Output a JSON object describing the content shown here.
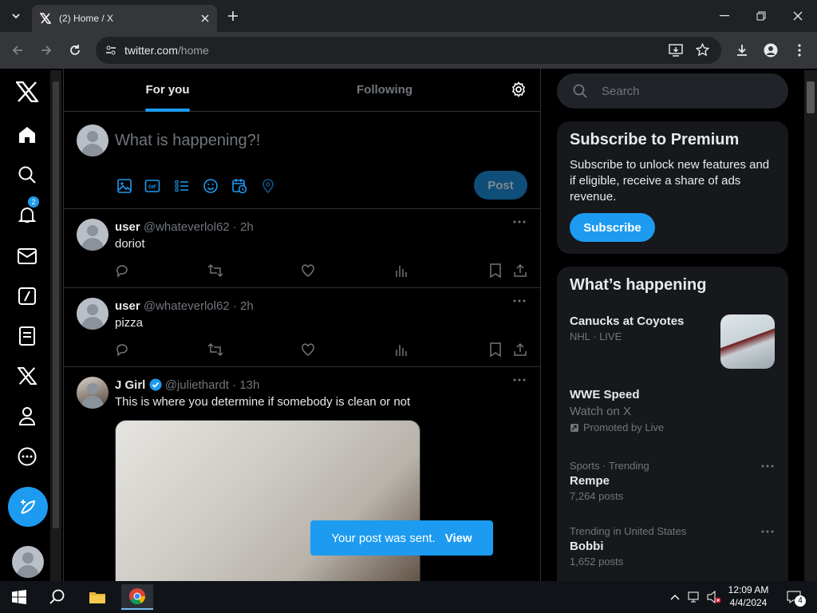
{
  "browser": {
    "tab_title": "(2) Home / X",
    "url_host": "twitter.com",
    "url_path": "/home"
  },
  "nav": {
    "notification_count": "2"
  },
  "timeline": {
    "tabs": [
      "For you",
      "Following"
    ],
    "composer_placeholder": "What is happening?!",
    "post_label": "Post"
  },
  "tweets": [
    {
      "name": "user",
      "handle": "@whateverlol62 · 2h",
      "text": "doriot"
    },
    {
      "name": "user",
      "handle": "@whateverlol62 · 2h",
      "text": "pizza"
    },
    {
      "name": "J Girl",
      "handle": "@juliethardt · 13h",
      "text": "This is where you determine if somebody is clean or not"
    }
  ],
  "toast": {
    "message": "Your post was sent.",
    "action": "View"
  },
  "sidebar": {
    "search_placeholder": "Search",
    "premium": {
      "title": "Subscribe to Premium",
      "text": "Subscribe to unlock new features and if eligible, receive a share of ads revenue.",
      "button": "Subscribe"
    },
    "happening": {
      "title": "What’s happening",
      "trends": [
        {
          "title": "Canucks at Coyotes",
          "meta": "NHL · LIVE"
        },
        {
          "title": "WWE Speed",
          "sub": "Watch on X",
          "meta": "Promoted by Live"
        },
        {
          "meta": "Sports · Trending",
          "title": "Rempe",
          "sub": "7,264 posts"
        },
        {
          "meta": "Trending in United States",
          "title": "Bobbi",
          "sub": "1,652 posts"
        }
      ]
    }
  },
  "taskbar": {
    "time": "12:09 AM",
    "date": "4/4/2024",
    "notifications": "4"
  },
  "colors": {
    "accent": "#1d9bf0",
    "background": "#000000",
    "card": "#16181c"
  }
}
